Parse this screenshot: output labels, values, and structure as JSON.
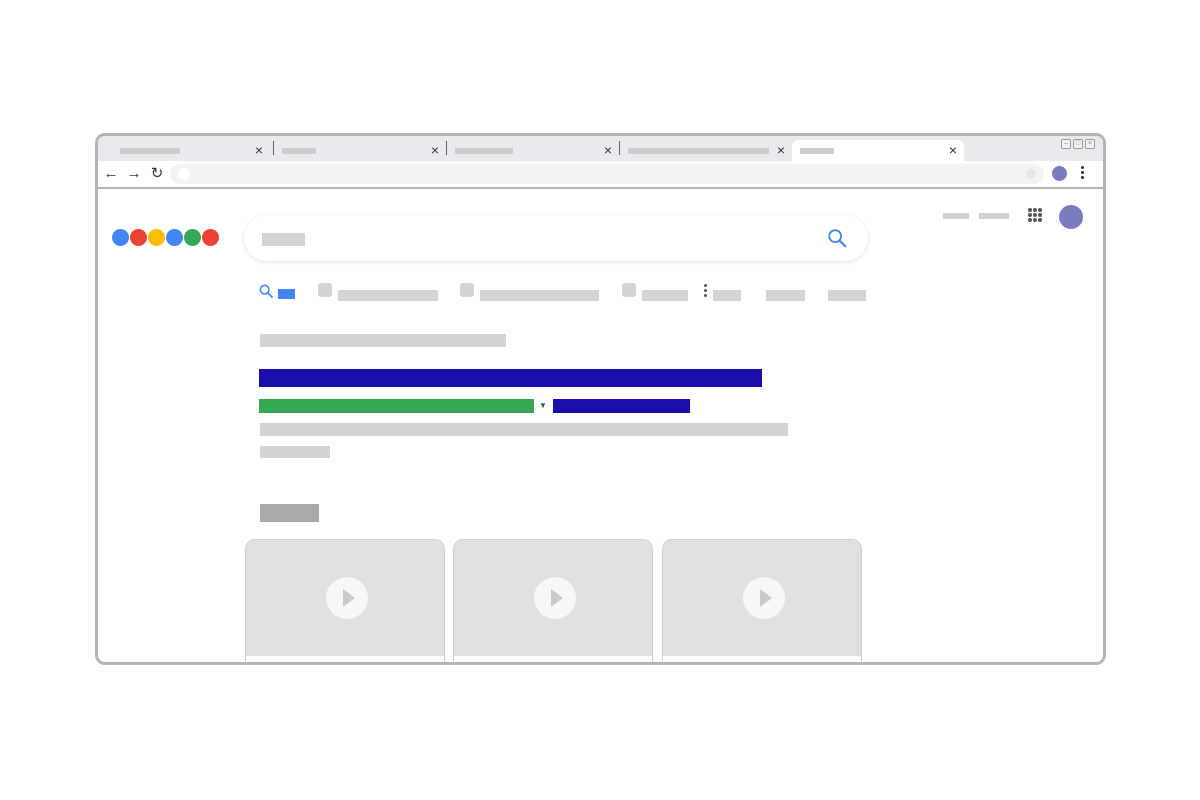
{
  "browser": {
    "tabs": [
      {
        "close_label": "×"
      },
      {
        "close_label": "×"
      },
      {
        "close_label": "×"
      },
      {
        "close_label": "×"
      },
      {
        "close_label": "×",
        "active": true
      }
    ],
    "toolbar": {
      "back_label": "←",
      "forward_label": "→",
      "reload_label": "↻"
    },
    "window_controls": {
      "minimize_label": "–",
      "restore_label": "□",
      "close_label": "×"
    }
  },
  "colors": {
    "logo": [
      "#4285f4",
      "#ea4335",
      "#fbbc05",
      "#4285f4",
      "#34a853",
      "#ea4335"
    ],
    "result_title": "#1a0dab",
    "result_url": "#34a853",
    "avatar": "#7b7cbd",
    "accent": "#4285f4"
  },
  "icons": {
    "search": "search-icon",
    "play": "play-icon",
    "apps": "apps-grid-icon",
    "more": "more-vert-icon"
  }
}
